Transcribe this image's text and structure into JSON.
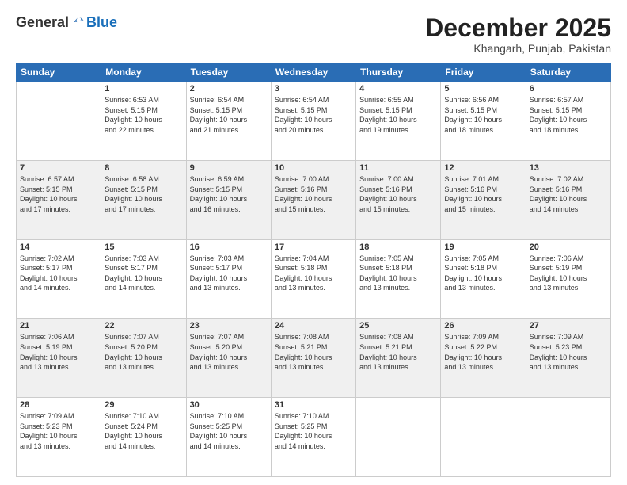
{
  "logo": {
    "general": "General",
    "blue": "Blue"
  },
  "header": {
    "month": "December 2025",
    "location": "Khangarh, Punjab, Pakistan"
  },
  "weekdays": [
    "Sunday",
    "Monday",
    "Tuesday",
    "Wednesday",
    "Thursday",
    "Friday",
    "Saturday"
  ],
  "weeks": [
    [
      {
        "day": "",
        "info": ""
      },
      {
        "day": "1",
        "info": "Sunrise: 6:53 AM\nSunset: 5:15 PM\nDaylight: 10 hours\nand 22 minutes."
      },
      {
        "day": "2",
        "info": "Sunrise: 6:54 AM\nSunset: 5:15 PM\nDaylight: 10 hours\nand 21 minutes."
      },
      {
        "day": "3",
        "info": "Sunrise: 6:54 AM\nSunset: 5:15 PM\nDaylight: 10 hours\nand 20 minutes."
      },
      {
        "day": "4",
        "info": "Sunrise: 6:55 AM\nSunset: 5:15 PM\nDaylight: 10 hours\nand 19 minutes."
      },
      {
        "day": "5",
        "info": "Sunrise: 6:56 AM\nSunset: 5:15 PM\nDaylight: 10 hours\nand 18 minutes."
      },
      {
        "day": "6",
        "info": "Sunrise: 6:57 AM\nSunset: 5:15 PM\nDaylight: 10 hours\nand 18 minutes."
      }
    ],
    [
      {
        "day": "7",
        "info": "Sunrise: 6:57 AM\nSunset: 5:15 PM\nDaylight: 10 hours\nand 17 minutes."
      },
      {
        "day": "8",
        "info": "Sunrise: 6:58 AM\nSunset: 5:15 PM\nDaylight: 10 hours\nand 17 minutes."
      },
      {
        "day": "9",
        "info": "Sunrise: 6:59 AM\nSunset: 5:15 PM\nDaylight: 10 hours\nand 16 minutes."
      },
      {
        "day": "10",
        "info": "Sunrise: 7:00 AM\nSunset: 5:16 PM\nDaylight: 10 hours\nand 15 minutes."
      },
      {
        "day": "11",
        "info": "Sunrise: 7:00 AM\nSunset: 5:16 PM\nDaylight: 10 hours\nand 15 minutes."
      },
      {
        "day": "12",
        "info": "Sunrise: 7:01 AM\nSunset: 5:16 PM\nDaylight: 10 hours\nand 15 minutes."
      },
      {
        "day": "13",
        "info": "Sunrise: 7:02 AM\nSunset: 5:16 PM\nDaylight: 10 hours\nand 14 minutes."
      }
    ],
    [
      {
        "day": "14",
        "info": "Sunrise: 7:02 AM\nSunset: 5:17 PM\nDaylight: 10 hours\nand 14 minutes."
      },
      {
        "day": "15",
        "info": "Sunrise: 7:03 AM\nSunset: 5:17 PM\nDaylight: 10 hours\nand 14 minutes."
      },
      {
        "day": "16",
        "info": "Sunrise: 7:03 AM\nSunset: 5:17 PM\nDaylight: 10 hours\nand 13 minutes."
      },
      {
        "day": "17",
        "info": "Sunrise: 7:04 AM\nSunset: 5:18 PM\nDaylight: 10 hours\nand 13 minutes."
      },
      {
        "day": "18",
        "info": "Sunrise: 7:05 AM\nSunset: 5:18 PM\nDaylight: 10 hours\nand 13 minutes."
      },
      {
        "day": "19",
        "info": "Sunrise: 7:05 AM\nSunset: 5:18 PM\nDaylight: 10 hours\nand 13 minutes."
      },
      {
        "day": "20",
        "info": "Sunrise: 7:06 AM\nSunset: 5:19 PM\nDaylight: 10 hours\nand 13 minutes."
      }
    ],
    [
      {
        "day": "21",
        "info": "Sunrise: 7:06 AM\nSunset: 5:19 PM\nDaylight: 10 hours\nand 13 minutes."
      },
      {
        "day": "22",
        "info": "Sunrise: 7:07 AM\nSunset: 5:20 PM\nDaylight: 10 hours\nand 13 minutes."
      },
      {
        "day": "23",
        "info": "Sunrise: 7:07 AM\nSunset: 5:20 PM\nDaylight: 10 hours\nand 13 minutes."
      },
      {
        "day": "24",
        "info": "Sunrise: 7:08 AM\nSunset: 5:21 PM\nDaylight: 10 hours\nand 13 minutes."
      },
      {
        "day": "25",
        "info": "Sunrise: 7:08 AM\nSunset: 5:21 PM\nDaylight: 10 hours\nand 13 minutes."
      },
      {
        "day": "26",
        "info": "Sunrise: 7:09 AM\nSunset: 5:22 PM\nDaylight: 10 hours\nand 13 minutes."
      },
      {
        "day": "27",
        "info": "Sunrise: 7:09 AM\nSunset: 5:23 PM\nDaylight: 10 hours\nand 13 minutes."
      }
    ],
    [
      {
        "day": "28",
        "info": "Sunrise: 7:09 AM\nSunset: 5:23 PM\nDaylight: 10 hours\nand 13 minutes."
      },
      {
        "day": "29",
        "info": "Sunrise: 7:10 AM\nSunset: 5:24 PM\nDaylight: 10 hours\nand 14 minutes."
      },
      {
        "day": "30",
        "info": "Sunrise: 7:10 AM\nSunset: 5:25 PM\nDaylight: 10 hours\nand 14 minutes."
      },
      {
        "day": "31",
        "info": "Sunrise: 7:10 AM\nSunset: 5:25 PM\nDaylight: 10 hours\nand 14 minutes."
      },
      {
        "day": "",
        "info": ""
      },
      {
        "day": "",
        "info": ""
      },
      {
        "day": "",
        "info": ""
      }
    ]
  ]
}
